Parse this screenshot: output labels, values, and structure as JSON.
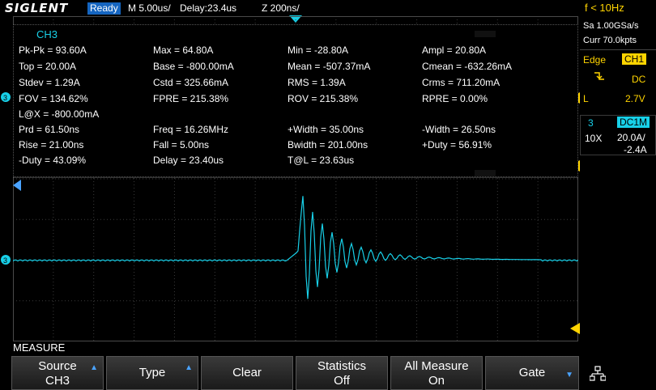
{
  "topbar": {
    "brand": "SIGLENT",
    "status": "Ready",
    "timebase": "M 5.00us/",
    "delay": "Delay:23.4us",
    "zoom": "Z 200ns/",
    "trigger_freq": "f < 10Hz"
  },
  "acquisition": {
    "sample_rate": "Sa 1.00GSa/s",
    "memory": "Curr 70.0kpts"
  },
  "trigger": {
    "type": "Edge",
    "source": "CH1",
    "coupling": "DC",
    "slope_label": "L",
    "level": "2.7V"
  },
  "channel": {
    "number": "3",
    "coupling": "DC1M",
    "probe": "10X",
    "scale": "20.0A/",
    "offset": "-2.4A"
  },
  "measurement": {
    "channel": "CH3",
    "rows": [
      [
        "Pk-Pk = 93.60A",
        "Max = 64.80A",
        "Min = -28.80A",
        "Ampl = 20.80A"
      ],
      [
        "Top = 20.00A",
        "Base = -800.00mA",
        "Mean = -507.37mA",
        "Cmean = -632.26mA"
      ],
      [
        "Stdev = 1.29A",
        "Cstd = 325.66mA",
        "RMS = 1.39A",
        "Crms = 711.20mA"
      ],
      [
        "FOV = 134.62%",
        "FPRE = 215.38%",
        "ROV = 215.38%",
        "RPRE = 0.00%"
      ],
      [
        "L@X = -800.00mA",
        "",
        "",
        ""
      ],
      [
        "Prd = 61.50ns",
        "Freq = 16.26MHz",
        "+Width = 35.00ns",
        "-Width = 26.50ns"
      ],
      [
        "Rise = 21.00ns",
        "Fall = 5.00ns",
        "Bwidth = 201.00ns",
        "+Duty = 56.91%"
      ],
      [
        "-Duty = 43.09%",
        "Delay = 23.40us",
        "T@L = 23.63us",
        ""
      ]
    ]
  },
  "menu": {
    "title": "MEASURE",
    "source_l1": "Source",
    "source_l2": "CH3",
    "type": "Type",
    "clear": "Clear",
    "statistics_l1": "Statistics",
    "statistics_l2": "Off",
    "allmeasure_l1": "All Measure",
    "allmeasure_l2": "On",
    "gate": "Gate"
  },
  "colors": {
    "trace": "#18d0e8",
    "trigger": "#ffd400",
    "accent": "#1565c0"
  }
}
